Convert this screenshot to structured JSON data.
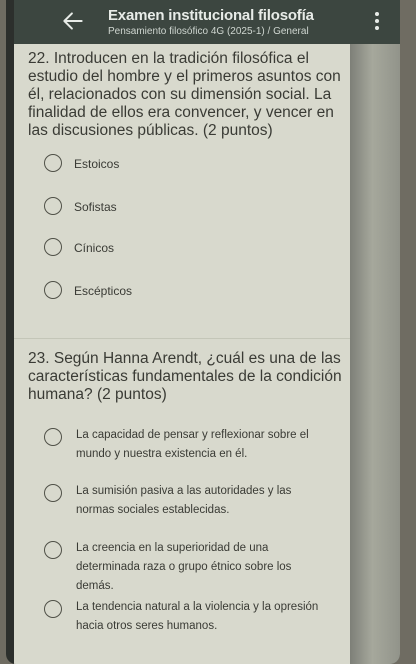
{
  "header": {
    "title": "Examen institucional filosofía",
    "subtitle": "Pensamiento filosófico 4G (2025-1) / General"
  },
  "questions": [
    {
      "text": "22. Introducen en la tradición filosófica el estudio del hombre y el primeros asuntos con él, relacionados con su dimensión social. La finalidad de ellos era convencer, y vencer en las discusiones públicas. (2 puntos)",
      "options": [
        "Estoicos",
        "Sofistas",
        "Cínicos",
        "Escépticos"
      ]
    },
    {
      "text": "23. Según Hanna Arendt, ¿cuál es una de las características fundamentales de la condición humana? (2 puntos)",
      "options": [
        "La capacidad de pensar y reflexionar sobre el mundo y nuestra existencia en él.",
        "La sumisión pasiva a las autoridades y las normas sociales establecidas.",
        "La creencia en la superioridad de una determinada raza o grupo étnico sobre los demás.",
        "La tendencia natural a la violencia y la opresión hacia otros seres humanos."
      ]
    }
  ],
  "icons": {
    "back": "arrow-left-icon",
    "menu": "more-vertical-icon"
  },
  "colors": {
    "app_bar": "#3c4640",
    "content_bg": "#d8d9cd",
    "text": "#3a3b35"
  }
}
